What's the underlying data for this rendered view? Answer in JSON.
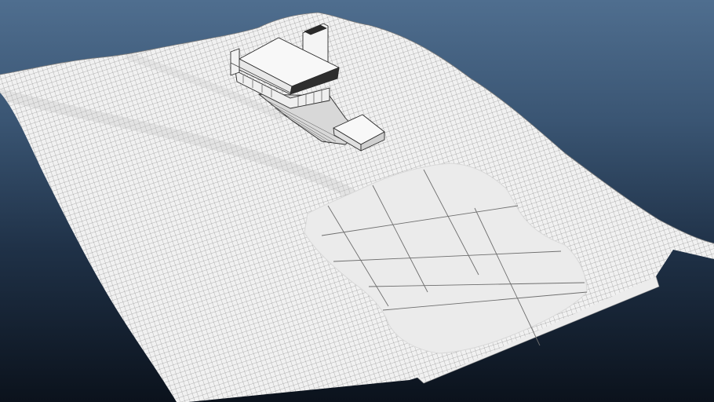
{
  "viewport": {
    "background_top": "#4f6e8f",
    "background_bottom": "#0b121c",
    "mesh_fill": "#f1f1f1",
    "mesh_line": "#5a5a5a",
    "water_fill": "#ebebeb",
    "water_line": "#6e6e6e",
    "building_fill": "#f7f7f7",
    "building_line": "#2b2b2b"
  }
}
